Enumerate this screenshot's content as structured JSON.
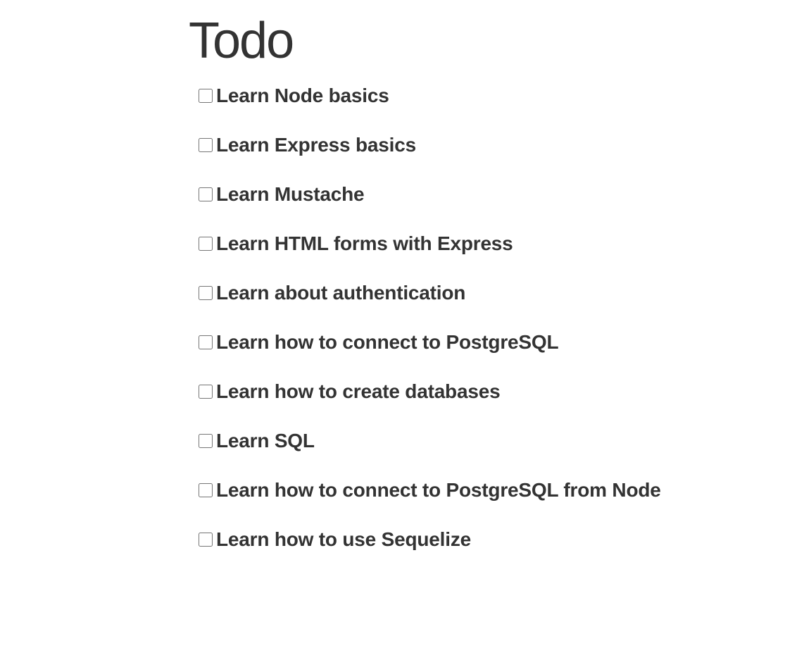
{
  "title": "Todo",
  "todos": [
    {
      "label": "Learn Node basics",
      "checked": false
    },
    {
      "label": "Learn Express basics",
      "checked": false
    },
    {
      "label": "Learn Mustache",
      "checked": false
    },
    {
      "label": "Learn HTML forms with Express",
      "checked": false
    },
    {
      "label": "Learn about authentication",
      "checked": false
    },
    {
      "label": "Learn how to connect to PostgreSQL",
      "checked": false
    },
    {
      "label": "Learn how to create databases",
      "checked": false
    },
    {
      "label": "Learn SQL",
      "checked": false
    },
    {
      "label": "Learn how to connect to PostgreSQL from Node",
      "checked": false
    },
    {
      "label": "Learn how to use Sequelize",
      "checked": false
    }
  ]
}
